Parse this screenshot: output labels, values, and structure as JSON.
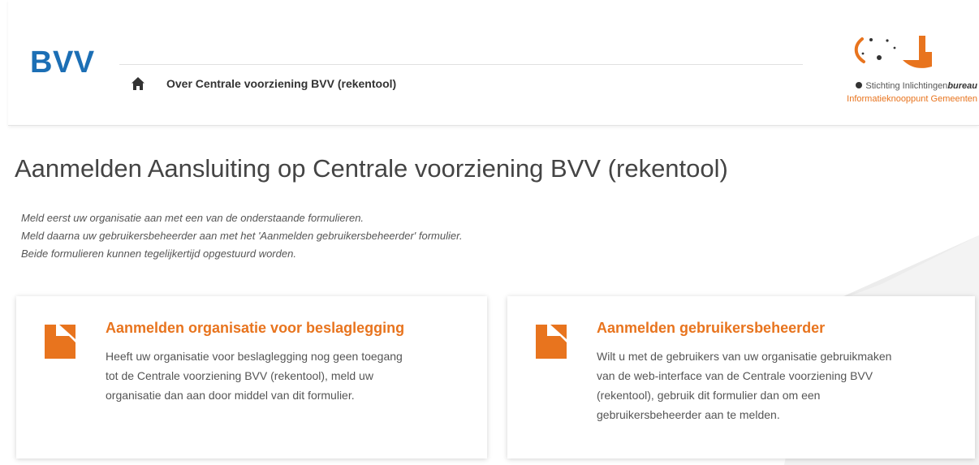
{
  "header": {
    "brand": "BVV",
    "nav_link": "Over Centrale voorziening BVV (rekentool)",
    "logo": {
      "line1_prefix": "Stichting Inlichtingen",
      "line1_bold": "bureau",
      "line2": "Informatieknooppunt Gemeenten"
    }
  },
  "main": {
    "title": "Aanmelden Aansluiting op Centrale voorziening BVV (rekentool)",
    "intro": [
      "Meld eerst uw organisatie aan met een van de onderstaande formulieren.",
      "Meld daarna uw gebruikersbeheerder aan met het 'Aanmelden gebruikersbeheerder' formulier.",
      "Beide formulieren kunnen tegelijkertijd opgestuurd worden."
    ],
    "cards": [
      {
        "title": "Aanmelden organisatie voor beslaglegging",
        "lines": [
          "Heeft uw organisatie voor beslaglegging nog geen toegang",
          "tot de Centrale voorziening BVV (rekentool), meld uw",
          "organisatie dan aan door middel van dit formulier."
        ]
      },
      {
        "title": "Aanmelden gebruikersbeheerder",
        "lines": [
          "Wilt u met de gebruikers van uw organisatie gebruikmaken",
          "van de web-interface van de Centrale voorziening BVV",
          "(rekentool), gebruik dit formulier dan om een",
          "gebruikersbeheerder aan te melden."
        ]
      }
    ]
  },
  "colors": {
    "brand_blue": "#1c6fb5",
    "accent_orange": "#e8741e"
  },
  "icons": {
    "home": "home-icon",
    "document": "document-icon",
    "logo": "logo-mark-icon"
  }
}
